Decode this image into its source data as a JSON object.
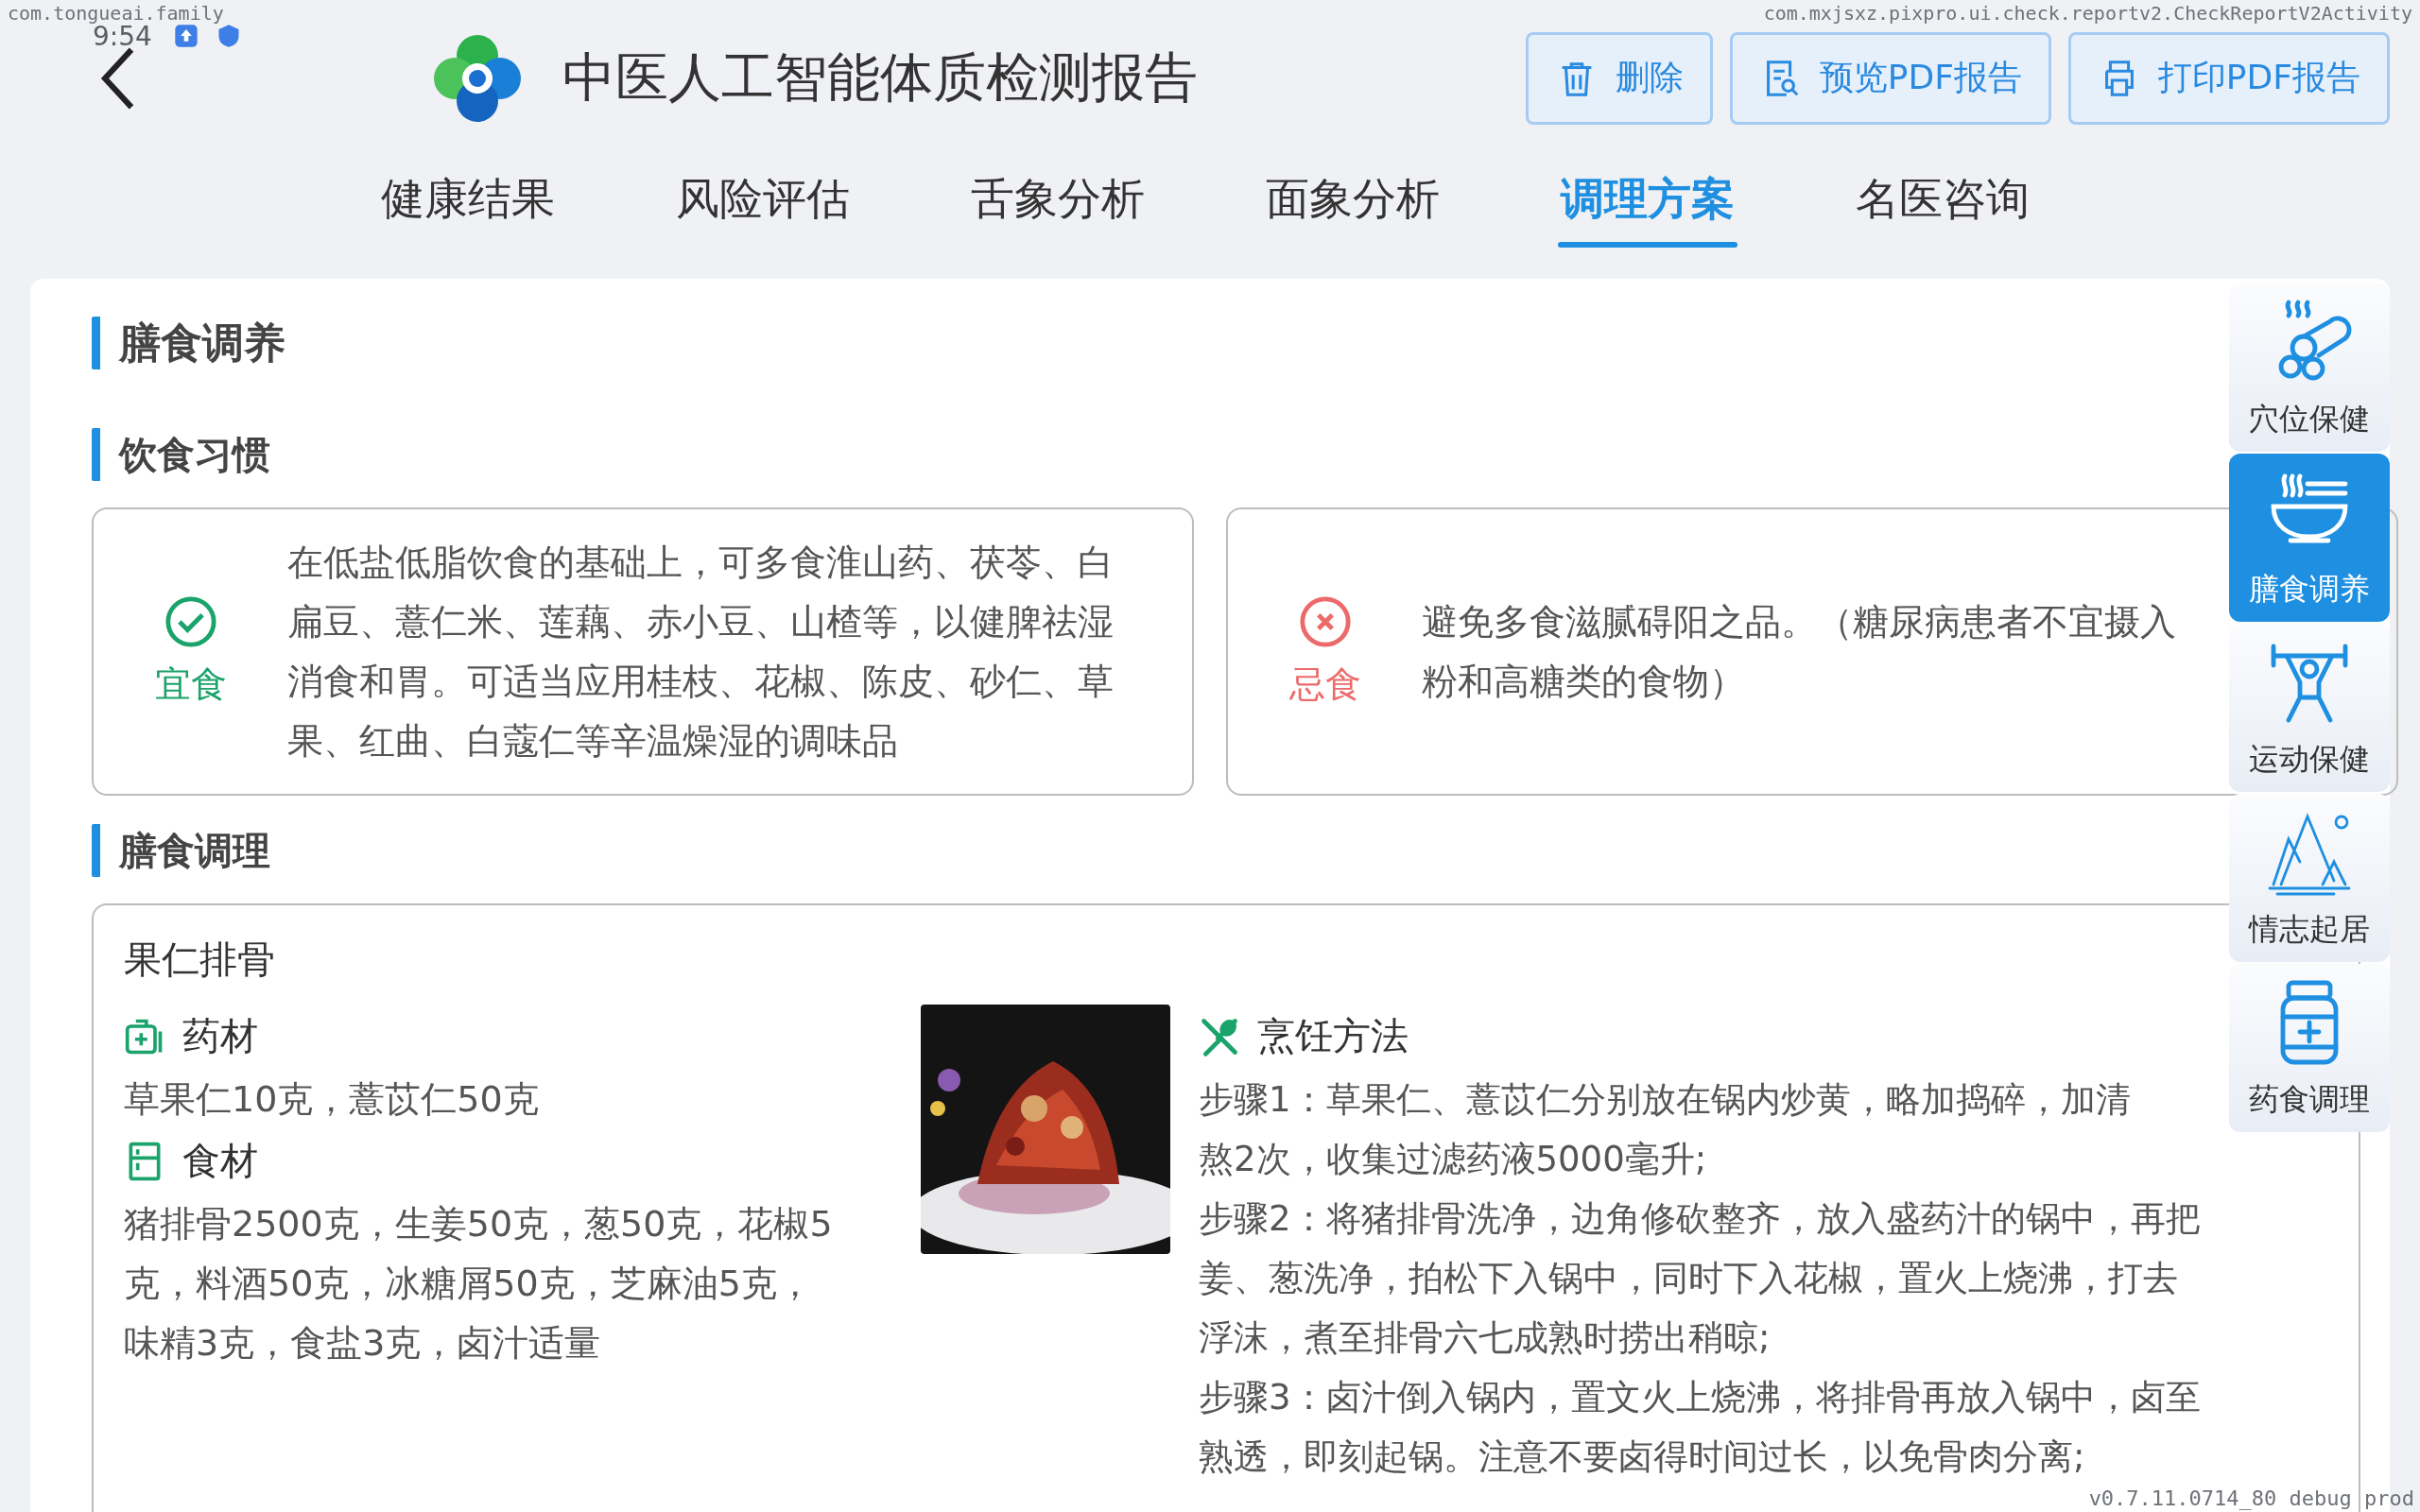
{
  "debug_overlay": {
    "package": "com.tongueai.family",
    "time": "9:54",
    "activity": "com.mxjsxz.pixpro.ui.check.reportv2.CheckReportV2Activity",
    "version": "v0.7.11.0714_80 debug prod"
  },
  "header": {
    "title": "中医人工智能体质检测报告",
    "buttons": [
      {
        "kind": "delete",
        "label": "删除"
      },
      {
        "kind": "preview",
        "label": "预览PDF报告"
      },
      {
        "kind": "print",
        "label": "打印PDF报告"
      }
    ]
  },
  "tabs": [
    {
      "label": "健康结果",
      "selected": false
    },
    {
      "label": "风险评估",
      "selected": false
    },
    {
      "label": "舌象分析",
      "selected": false
    },
    {
      "label": "面象分析",
      "selected": false
    },
    {
      "label": "调理方案",
      "selected": true
    },
    {
      "label": "名医咨询",
      "selected": false
    }
  ],
  "section": {
    "title": "膳食调养"
  },
  "habits": {
    "title": "饮食习惯",
    "cards": [
      {
        "kind": "suitable",
        "label": "宜食",
        "lines": [
          "在低盐低脂饮食的基础上，可多食淮山药、茯苓、白",
          "扁豆、薏仁米、莲藕、赤小豆、山楂等，以健脾祛湿",
          "消食和胃。可适当应用桂枝、花椒、陈皮、砂仁、草",
          "果、红曲、白蔻仁等辛温燥湿的调味品"
        ]
      },
      {
        "kind": "avoid",
        "label": "忌食",
        "lines": [
          "避免多食滋腻碍阳之品。（糖尿病患者不宜摄入",
          "粉和高糖类的食物）"
        ]
      }
    ]
  },
  "recipes": {
    "title": "膳食调理",
    "items": [
      {
        "name": "果仁排骨",
        "herbs_label": "药材",
        "herbs": "草果仁10克，薏苡仁50克",
        "ingredients_label": "食材",
        "ingredients_lines": [
          "猪排骨2500克，生姜50克，葱50克，花椒5",
          "克，料酒50克，冰糖屑50克，芝麻油5克，",
          "味精3克，食盐3克，卤汁适量"
        ],
        "method_label": "烹饪方法",
        "method_lines": [
          "步骤1：草果仁、薏苡仁分别放在锅内炒黄，略加捣碎，加清",
          "熬2次，收集过滤药液5000毫升;",
          "步骤2：将猪排骨洗净，边角修砍整齐，放入盛药汁的锅中，再把",
          "姜、葱洗净，拍松下入锅中，同时下入花椒，置火上烧沸，打去",
          "浮沫，煮至排骨六七成熟时捞出稍晾;",
          "步骤3：卤汁倒入锅内，置文火上烧沸，将排骨再放入锅中，卤至",
          "熟透，即刻起锅。注意不要卤得时间过长，以免骨肉分离;"
        ]
      }
    ]
  },
  "side_menu": [
    {
      "kind": "acupoint",
      "label": "穴位保健",
      "selected": false
    },
    {
      "kind": "diet",
      "label": "膳食调养",
      "selected": true
    },
    {
      "kind": "exercise",
      "label": "运动保健",
      "selected": false
    },
    {
      "kind": "mood",
      "label": "情志起居",
      "selected": false
    },
    {
      "kind": "medicine",
      "label": "药食调理",
      "selected": false
    }
  ]
}
